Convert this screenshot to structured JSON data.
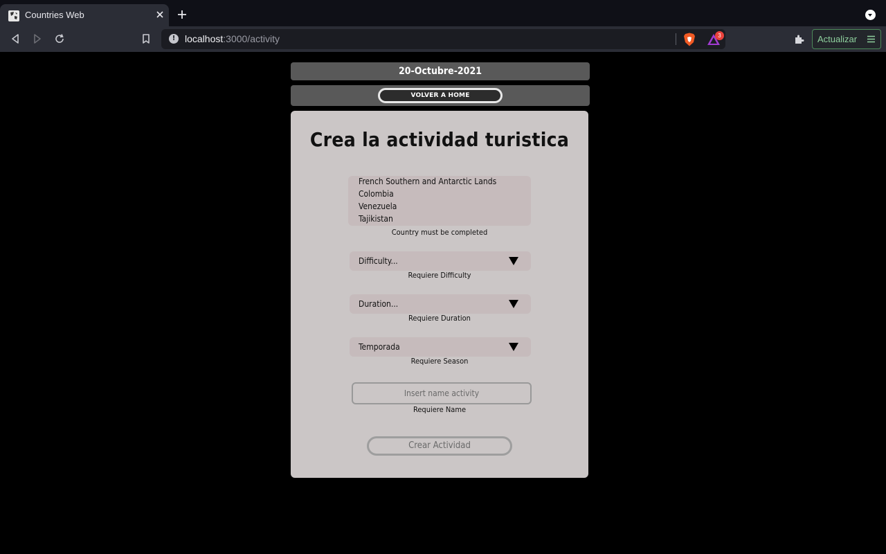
{
  "browser": {
    "tab_title": "Countries Web",
    "url_host": "localhost",
    "url_path": ":3000/activity",
    "rewards_count": "3",
    "update_label": "Actualizar"
  },
  "page": {
    "date": "20-Octubre-2021",
    "home_button": "VOLVER A HOME",
    "title": "Crea la actividad turistica",
    "countries": [
      "French Southern and Antarctic Lands",
      "Colombia",
      "Venezuela",
      "Tajikistan"
    ],
    "country_error": "Country must be completed",
    "difficulty": {
      "selected": "Difficulty...",
      "error": "Requiere Difficulty"
    },
    "duration": {
      "selected": "Duration...",
      "error": "Requiere Duration"
    },
    "season": {
      "selected": "Temporada",
      "error": "Requiere Season"
    },
    "name": {
      "placeholder": "Insert name activity",
      "error": "Requiere Name"
    },
    "submit_label": "Crear Actividad"
  },
  "colors": {
    "page_bg": "#000000",
    "bar_bg": "#595959",
    "card_bg": "#cbc6c6",
    "select_bg": "#c6bbbc"
  }
}
